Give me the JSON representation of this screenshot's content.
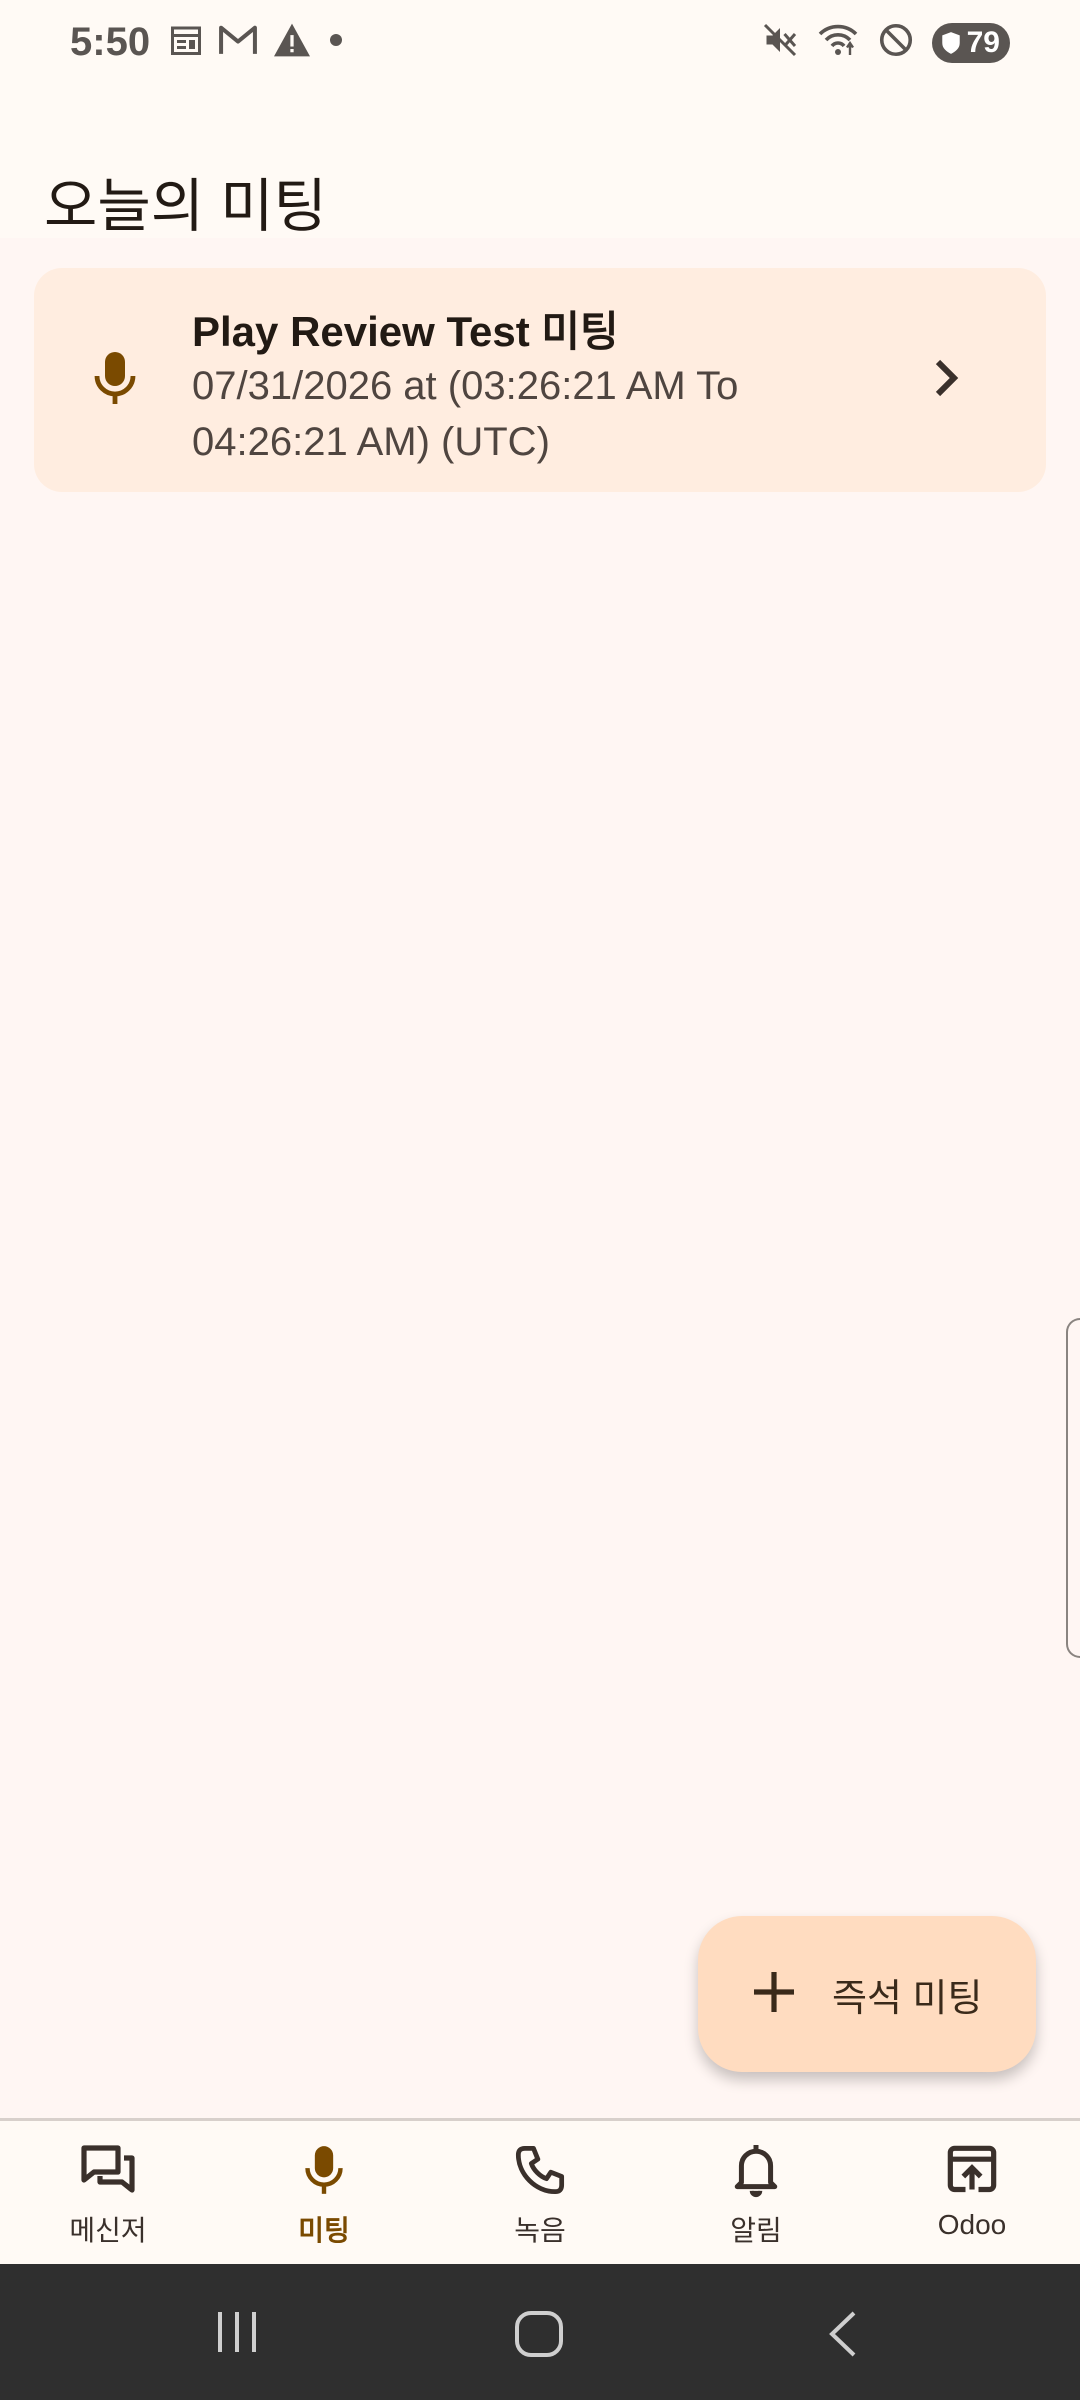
{
  "status_bar": {
    "time": "5:50",
    "battery": "79",
    "left_icons": [
      "calendar-icon",
      "gmail-icon",
      "warning-icon",
      "dot-icon"
    ],
    "right_icons": [
      "mute-icon",
      "wifi-icon",
      "do-not-disturb-icon",
      "battery-icon"
    ]
  },
  "app_bar": {
    "title": "오늘의 미팅"
  },
  "meetings": [
    {
      "icon": "mic-icon",
      "title": "Play Review Test 미팅",
      "schedule": "07/31/2026 at (03:26:21 AM To 04:26:21 AM) (UTC)"
    }
  ],
  "fab": {
    "icon": "plus-icon",
    "label": "즉석 미팅"
  },
  "bottom_nav": {
    "items": [
      {
        "label": "메신저",
        "icon": "chat-icon",
        "active": false
      },
      {
        "label": "미팅",
        "icon": "mic-icon",
        "active": true
      },
      {
        "label": "녹음",
        "icon": "phone-icon",
        "active": false
      },
      {
        "label": "알림",
        "icon": "bell-icon",
        "active": false
      },
      {
        "label": "Odoo",
        "icon": "open-in-browser-icon",
        "active": false
      }
    ]
  },
  "colors": {
    "accent": "#7a4a00",
    "card_bg": "#ffede0",
    "fab_bg": "#ffdcc0",
    "page_bg": "#fff6f3"
  }
}
